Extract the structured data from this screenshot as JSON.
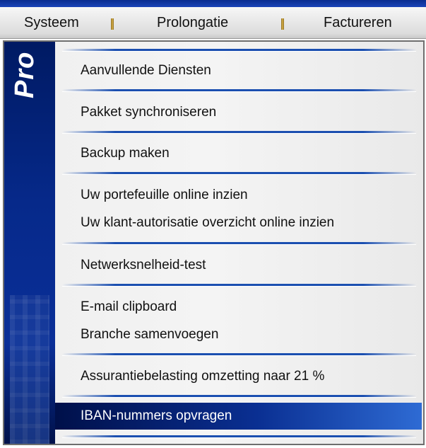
{
  "menubar": {
    "items": [
      {
        "label": "Systeem"
      },
      {
        "label": "Prolongatie"
      },
      {
        "label": "Factureren"
      }
    ]
  },
  "dropdown": {
    "sidebar_brand": "Pro",
    "selected_item": "IBAN-nummers opvragen",
    "items": [
      {
        "label": "Aanvullende Diensten"
      },
      {
        "label": "Pakket synchroniseren"
      },
      {
        "label": "Backup maken"
      },
      {
        "label": "Uw portefeuille online inzien"
      },
      {
        "label": "Uw klant-autorisatie overzicht online inzien"
      },
      {
        "label": "Netwerksnelheid-test"
      },
      {
        "label": "E-mail clipboard"
      },
      {
        "label": "Branche samenvoegen"
      },
      {
        "label": "Assurantiebelasting omzetting naar 21 %"
      },
      {
        "label": "IBAN-nummers opvragen"
      }
    ]
  },
  "colors": {
    "highlight": "#0a2f92",
    "sidebar": "#06298a",
    "divider": "#1b4fb0"
  }
}
